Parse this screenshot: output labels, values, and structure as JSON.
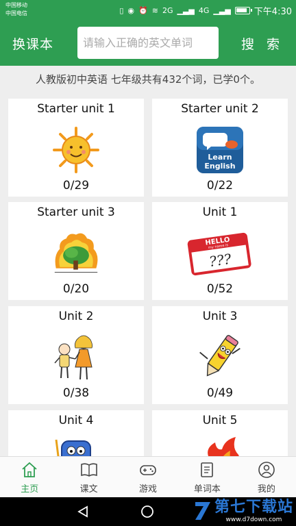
{
  "status": {
    "carrier1": "中国移动",
    "carrier2": "中国电信",
    "network1": "2G",
    "network2": "4G",
    "time": "下午4:30"
  },
  "appbar": {
    "switch_label": "换课本",
    "search_placeholder": "请输入正确的英文单词",
    "search_label": "搜 索"
  },
  "summary": "人教版初中英语 七年级共有432个词，已学0个。",
  "units": [
    {
      "title": "Starter unit 1",
      "count": "0/29",
      "icon": "smiling-sun-icon"
    },
    {
      "title": "Starter unit 2",
      "count": "0/22",
      "icon": "learn-english-badge-icon",
      "icon_text1": "Learn",
      "icon_text2": "English"
    },
    {
      "title": "Starter unit 3",
      "count": "0/20",
      "icon": "burning-tree-icon"
    },
    {
      "title": "Unit 1",
      "count": "0/52",
      "icon": "hello-name-tag-icon",
      "icon_text1": "HELLO",
      "icon_text2": "my name is",
      "icon_text3": "???"
    },
    {
      "title": "Unit 2",
      "count": "0/38",
      "icon": "two-kids-icon"
    },
    {
      "title": "Unit 3",
      "count": "0/49",
      "icon": "pencil-character-icon"
    },
    {
      "title": "Unit 4",
      "count": "",
      "icon": "blue-backpack-icon"
    },
    {
      "title": "Unit 5",
      "count": "",
      "icon": "flames-icon"
    }
  ],
  "tabs": [
    {
      "label": "主页",
      "icon": "home-icon",
      "active": true
    },
    {
      "label": "课文",
      "icon": "book-icon",
      "active": false
    },
    {
      "label": "游戏",
      "icon": "gamepad-icon",
      "active": false
    },
    {
      "label": "单词本",
      "icon": "notebook-icon",
      "active": false
    },
    {
      "label": "我的",
      "icon": "user-icon",
      "active": false
    }
  ],
  "watermark": {
    "text": "第七下载站",
    "url": "www.d7down.com"
  },
  "colors": {
    "primary": "#2e9e52",
    "background": "#eeeeee",
    "watermark": "#2a77d4"
  }
}
